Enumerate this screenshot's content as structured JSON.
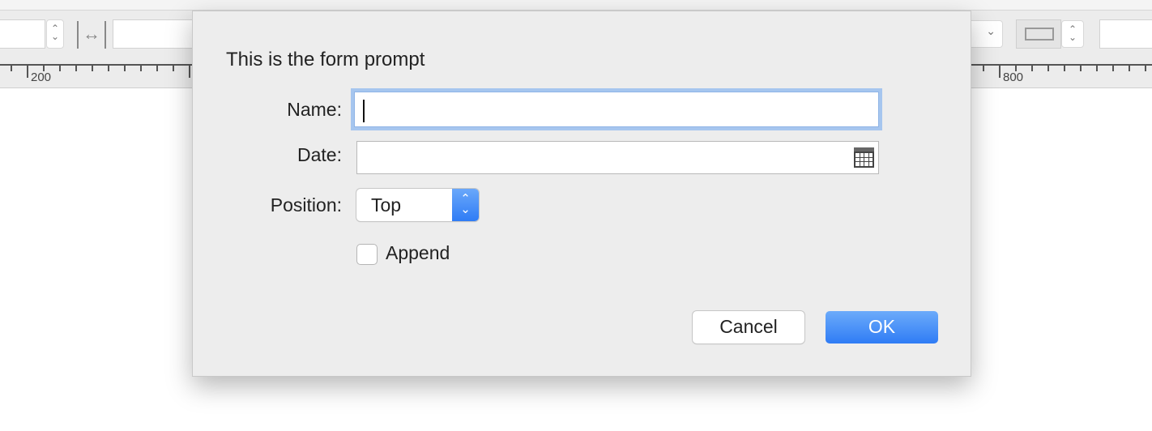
{
  "ruler": {
    "labels": [
      "200",
      "800"
    ]
  },
  "dialog": {
    "prompt": "This is the form prompt",
    "name_label": "Name:",
    "name_value": "",
    "date_label": "Date:",
    "date_value": "",
    "position_label": "Position:",
    "position_value": "Top",
    "append_label": "Append",
    "append_checked": false,
    "cancel_label": "Cancel",
    "ok_label": "OK",
    "accent_color": "#2f7cf5"
  }
}
